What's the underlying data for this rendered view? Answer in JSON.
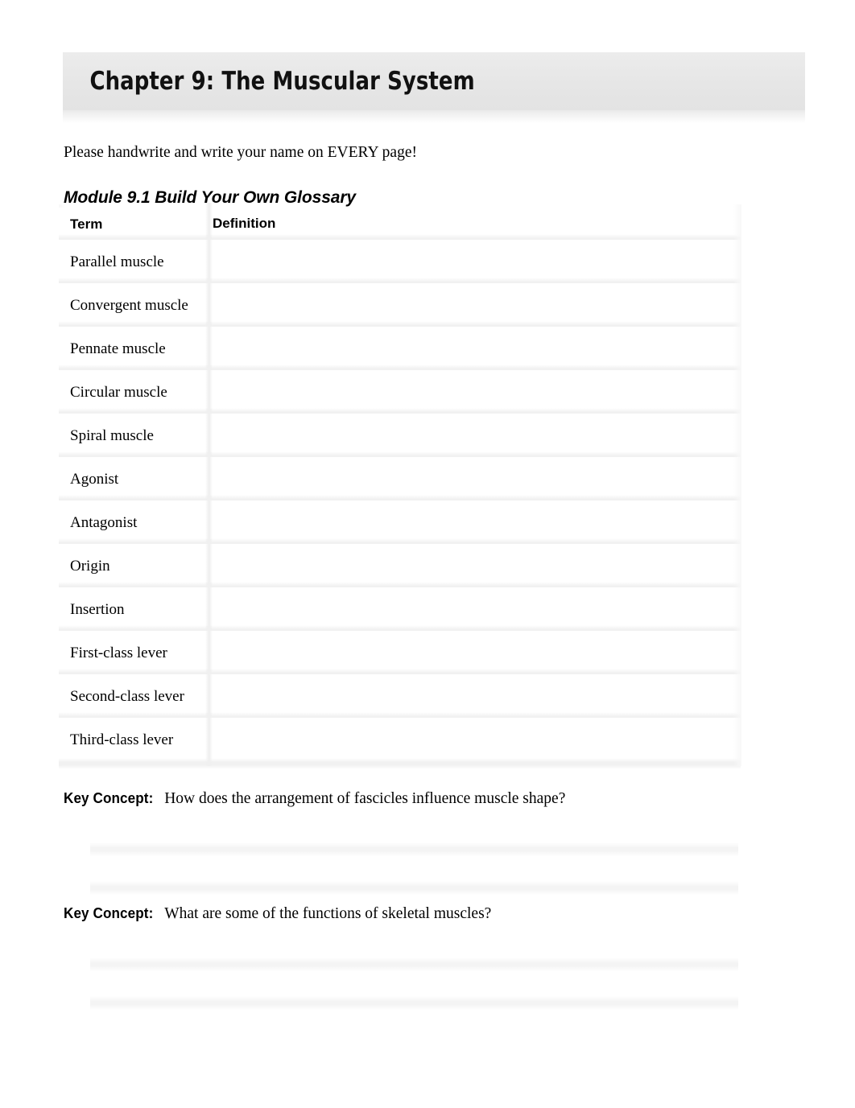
{
  "document": {
    "title": "Chapter 9: The Muscular System",
    "instruction": "Please handwrite and write your name on EVERY page!",
    "module_heading": "Module 9.1 Build Your Own Glossary"
  },
  "glossary": {
    "columns": [
      "Term",
      "Definition"
    ],
    "rows": [
      {
        "term": "Parallel muscle",
        "definition": ""
      },
      {
        "term": "Convergent muscle",
        "definition": ""
      },
      {
        "term": "Pennate muscle",
        "definition": ""
      },
      {
        "term": "Circular muscle",
        "definition": ""
      },
      {
        "term": "Spiral muscle",
        "definition": ""
      },
      {
        "term": "Agonist",
        "definition": ""
      },
      {
        "term": "Antagonist",
        "definition": ""
      },
      {
        "term": "Origin",
        "definition": ""
      },
      {
        "term": "Insertion",
        "definition": ""
      },
      {
        "term": "First-class lever",
        "definition": ""
      },
      {
        "term": "Second-class lever",
        "definition": ""
      },
      {
        "term": "Third-class lever",
        "definition": ""
      }
    ]
  },
  "key_concepts": [
    {
      "label": "Key Concept:",
      "question": "How does the arrangement of fascicles influence muscle shape?",
      "answer": ""
    },
    {
      "label": "Key Concept:",
      "question": "What are some of the functions of skeletal muscles?",
      "answer": ""
    }
  ],
  "colors": {
    "banner_background": "#e9e9e9",
    "page_background": "#ffffff",
    "text": "#000000",
    "row_separator": "#f1f1f1",
    "answer_band": "#f4f4f4"
  }
}
